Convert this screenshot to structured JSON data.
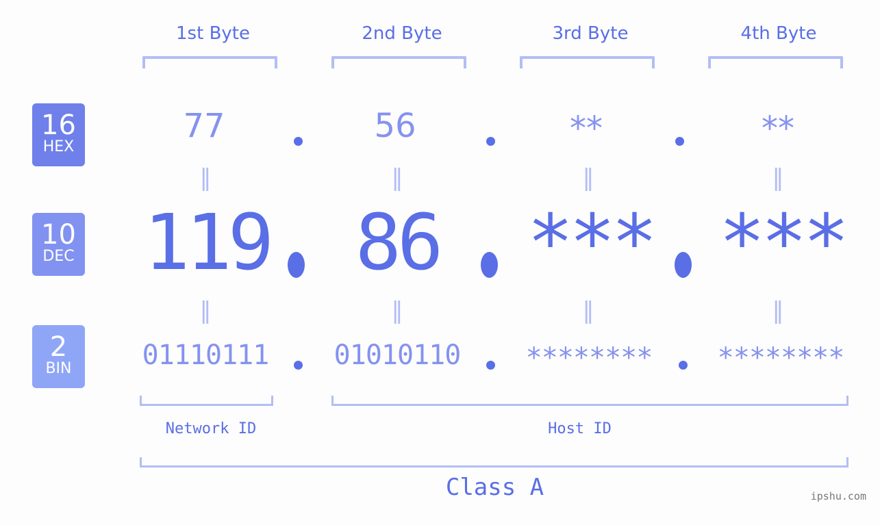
{
  "bytes": {
    "labels": [
      "1st Byte",
      "2nd Byte",
      "3rd Byte",
      "4th Byte"
    ]
  },
  "badges": {
    "hex": {
      "num": "16",
      "label": "HEX",
      "color": "#6f80ea"
    },
    "dec": {
      "num": "10",
      "label": "DEC",
      "color": "#8292f0"
    },
    "bin": {
      "num": "2",
      "label": "BIN",
      "color": "#8fa6f7"
    }
  },
  "hex_values": [
    "77",
    "56",
    "**",
    "**"
  ],
  "dec_values": [
    "119",
    "86",
    "***",
    "***"
  ],
  "bin_values": [
    "01110111",
    "01010110",
    "********",
    "********"
  ],
  "equals_sign": "=",
  "segments": {
    "network_id": "Network ID",
    "host_id": "Host ID",
    "class_label": "Class A"
  },
  "watermark": "ipshu.com",
  "colors": {
    "accent": "#5a6ee6",
    "light_accent": "#8592ef",
    "bracket": "#b3bdf6"
  }
}
